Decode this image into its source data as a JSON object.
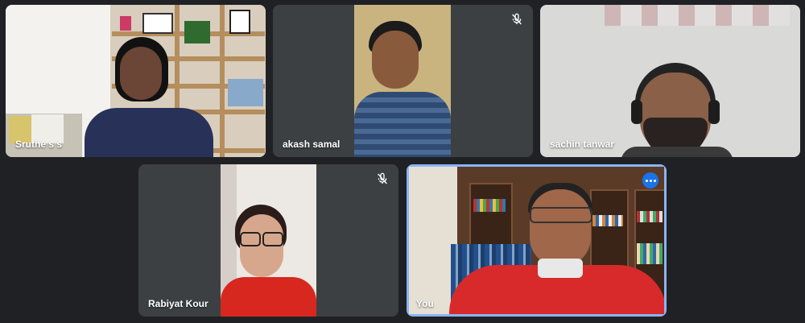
{
  "participants": [
    {
      "name": "Sruthe s s",
      "muted": false
    },
    {
      "name": "akash samal",
      "muted": true
    },
    {
      "name": "sachin tanwar",
      "muted": false
    },
    {
      "name": "Rabiyat Kour",
      "muted": true
    },
    {
      "name": "You",
      "muted": false
    }
  ],
  "icons": {
    "mute": "mic-off-icon",
    "more": "more-options-icon"
  },
  "colors": {
    "background": "#202124",
    "tile": "#3c4043",
    "active_border": "#8ab4f8",
    "more_button": "#1a73e8"
  }
}
